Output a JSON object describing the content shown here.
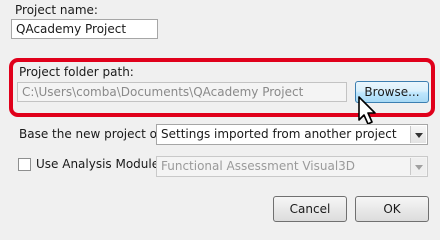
{
  "project_name": {
    "label": "Project name:",
    "value": "QAcademy Project"
  },
  "project_folder": {
    "label": "Project folder path:",
    "value": "C:\\Users\\comba\\Documents\\QAcademy Project",
    "browse_label": "Browse..."
  },
  "base_project": {
    "label": "Base the new project on:",
    "selected": "Settings imported from another project"
  },
  "analysis_module": {
    "label": "Use Analysis Module:",
    "checked": false,
    "selected": "Functional Assessment Visual3D"
  },
  "buttons": {
    "cancel_label": "Cancel",
    "ok_label": "OK"
  },
  "colors": {
    "highlight": "#e0001b",
    "hover_button": "#bee6fd"
  }
}
